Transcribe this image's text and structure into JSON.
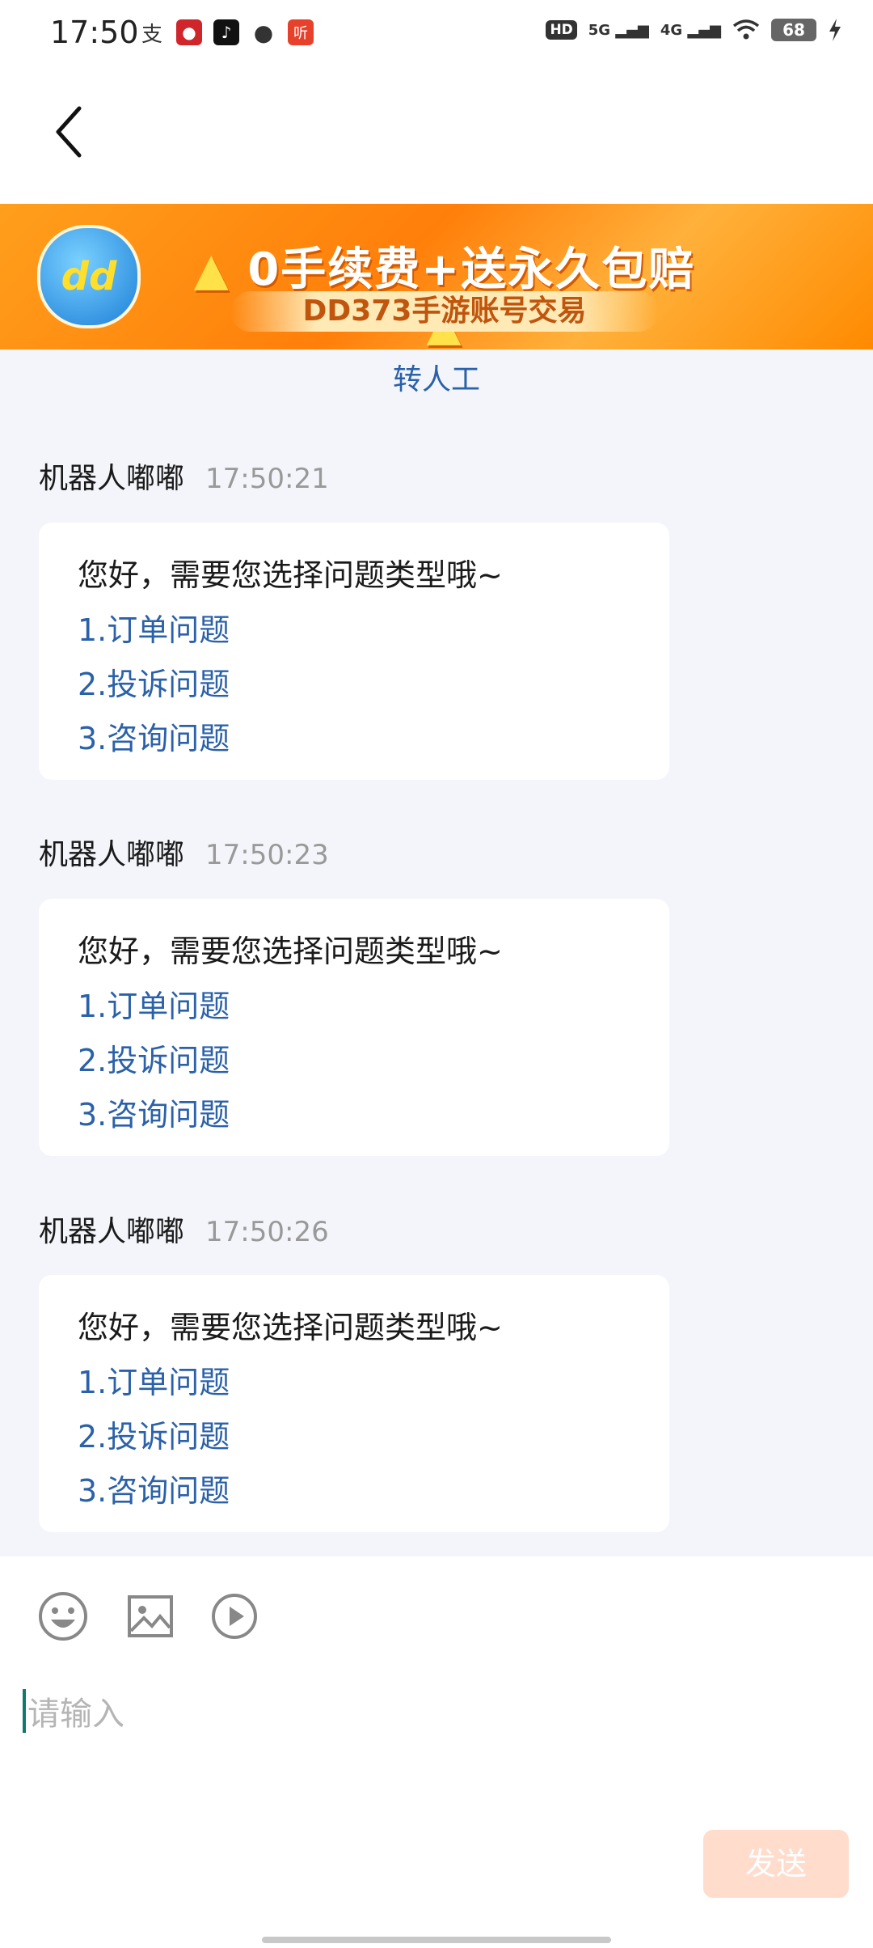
{
  "status_bar": {
    "time": "17:50",
    "notification_icons": [
      "alipay-icon",
      "weibo-app-icon",
      "tiktok-icon",
      "chat-bubble-icon",
      "listen-app-icon"
    ],
    "hd_label": "HD",
    "signal_1": "5G",
    "signal_2": "4G",
    "battery": "68"
  },
  "banner": {
    "logo_text": "dd",
    "headline": "0手续费+送永久包赔",
    "subline": "DD373手游账号交易",
    "brand_color": "#ff8a00"
  },
  "transfer_label": "转人工",
  "messages": [
    {
      "sender": "机器人嘟嘟",
      "time": "17:50:21",
      "text": "您好，需要您选择问题类型哦~",
      "options": [
        "1.订单问题",
        "2.投诉问题",
        "3.咨询问题"
      ]
    },
    {
      "sender": "机器人嘟嘟",
      "time": "17:50:23",
      "text": "您好，需要您选择问题类型哦~",
      "options": [
        "1.订单问题",
        "2.投诉问题",
        "3.咨询问题"
      ]
    },
    {
      "sender": "机器人嘟嘟",
      "time": "17:50:26",
      "text": "您好，需要您选择问题类型哦~",
      "options": [
        "1.订单问题",
        "2.投诉问题",
        "3.咨询问题"
      ]
    }
  ],
  "composer": {
    "placeholder": "请输入",
    "send_label": "发送",
    "tools": [
      "emoji-icon",
      "image-icon",
      "video-icon"
    ]
  },
  "colors": {
    "link": "#2b61a8",
    "background": "#f3f5fa",
    "send_disabled": "#ffdccc"
  }
}
